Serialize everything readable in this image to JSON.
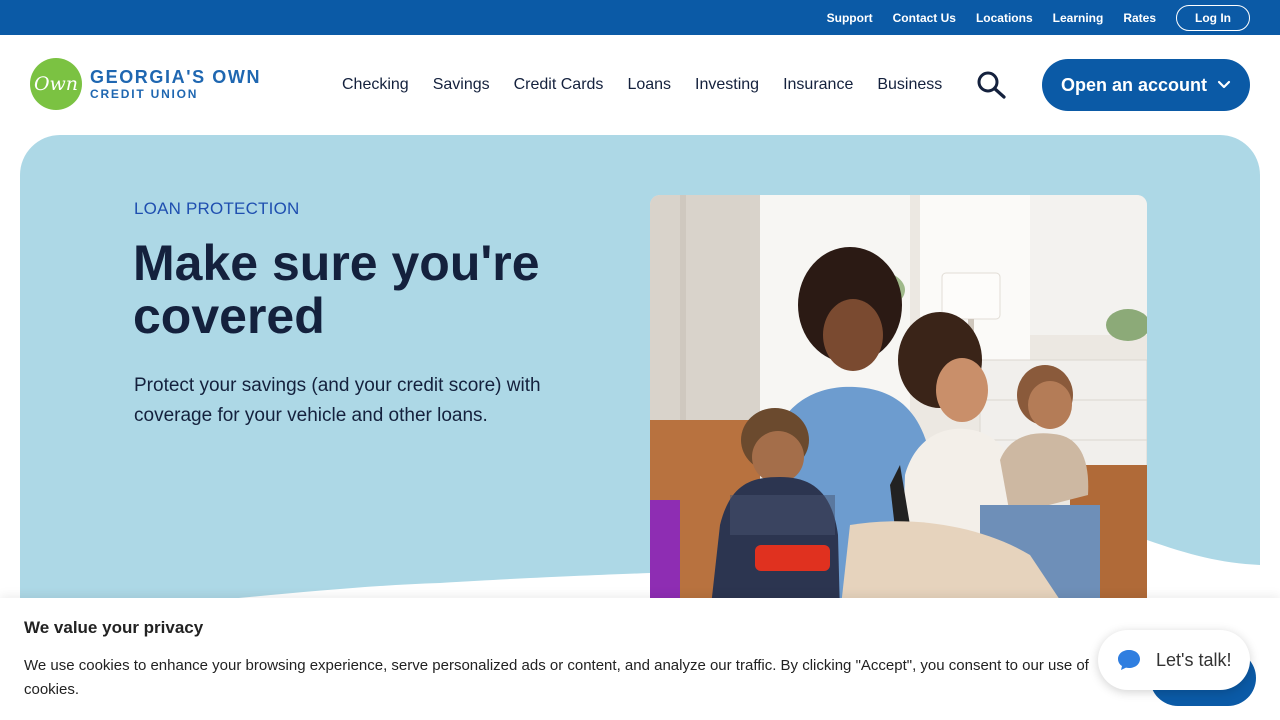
{
  "utility_bar": {
    "links": [
      "Support",
      "Contact Us",
      "Locations",
      "Learning",
      "Rates"
    ],
    "login_label": "Log In"
  },
  "logo": {
    "mark": "Own",
    "title": "GEORGIA'S OWN",
    "subtitle": "CREDIT UNION"
  },
  "nav": {
    "items": [
      "Checking",
      "Savings",
      "Credit Cards",
      "Loans",
      "Investing",
      "Insurance",
      "Business"
    ],
    "search_icon": "search-icon",
    "open_account_label": "Open an account"
  },
  "hero": {
    "eyebrow": "LOAN PROTECTION",
    "title": "Make sure you're covered",
    "description": "Protect your savings (and your credit score) with coverage for your vehicle and other loans."
  },
  "cookie_banner": {
    "title": "We value your privacy",
    "text": "We use cookies to enhance your browsing experience, serve personalized ads or content, and analyze our traffic. By clicking \"Accept\", you consent to our use of cookies."
  },
  "chat": {
    "label": "Let's talk!",
    "icon": "chat-bubble-icon"
  },
  "colors": {
    "brand_blue": "#0b5aa6",
    "hero_bg": "#add8e6",
    "logo_green": "#7bc242",
    "heading_navy": "#14213d"
  }
}
